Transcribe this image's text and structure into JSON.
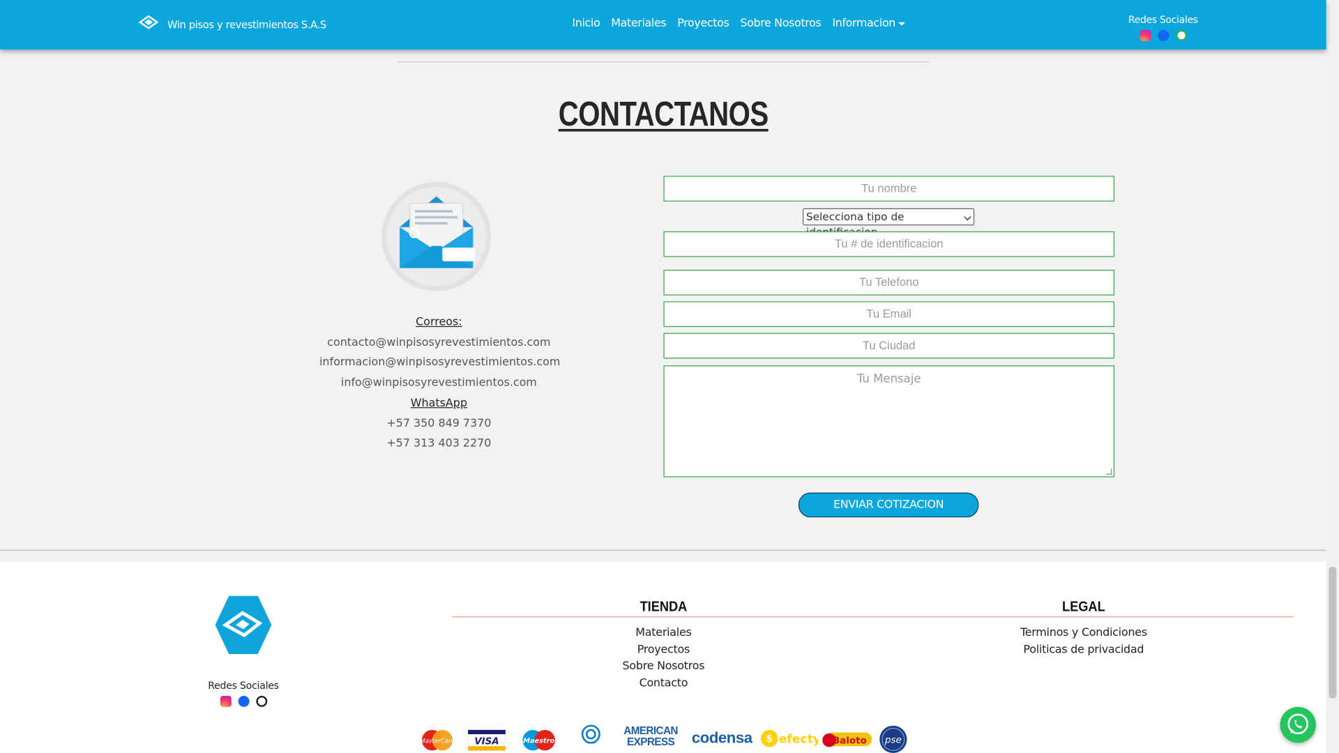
{
  "navbar": {
    "brand": "Win pisos y revestimientos S.A.S",
    "links": [
      "Inicio",
      "Materiales",
      "Proyectos",
      "Sobre Nosotros",
      "Informacion"
    ],
    "social_title": "Redes Sociales"
  },
  "contact": {
    "title": "CONTACTANOS",
    "emails_heading": "Correos:",
    "emails": [
      "contacto@winpisosyrevestimientos.com",
      "informacion@winpisosyrevestimientos.com",
      "info@winpisosyrevestimientos.com"
    ],
    "whatsapp_heading": "WhatsApp",
    "phones": [
      "+57 350 849 7370",
      "+57 313 403 2270"
    ]
  },
  "form": {
    "name_placeholder": "Tu nombre",
    "id_type_selected": "Selecciona tipo de identificacion",
    "id_number_placeholder": "Tu # de identificacion",
    "phone_placeholder": "Tu Telefono",
    "email_placeholder": "Tu Email",
    "city_placeholder": "Tu Ciudad",
    "message_placeholder": "Tu Mensaje",
    "submit_label": "ENVIAR COTIZACION"
  },
  "footer": {
    "social_title": "Redes Sociales",
    "tienda": {
      "title": "TIENDA",
      "links": [
        "Materiales",
        "Proyectos",
        "Sobre Nosotros",
        "Contacto"
      ]
    },
    "legal": {
      "title": "LEGAL",
      "links": [
        "Terminos y Condiciones",
        "Politicas de privacidad"
      ]
    },
    "payments": [
      "MasterCard",
      "VISA",
      "Maestro",
      "Diners Club",
      "AMERICAN",
      "EXPRESS",
      "codensa",
      "efecty",
      "Baloto",
      "pse"
    ]
  },
  "colors": {
    "brand_blue": "#0aa6dc",
    "field_border": "#3aa34a",
    "whatsapp_green": "#22c55e"
  }
}
